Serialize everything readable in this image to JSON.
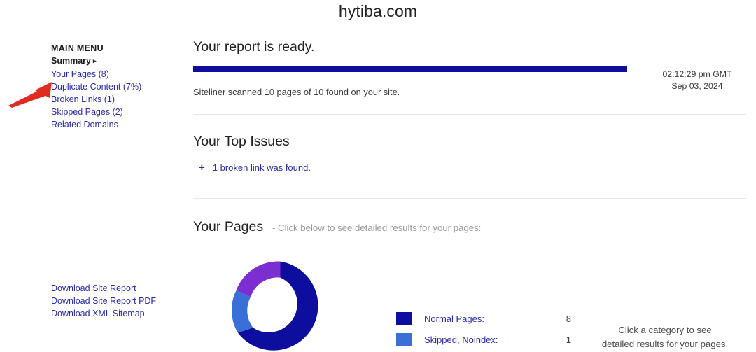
{
  "site": {
    "title": "hytiba.com"
  },
  "sidebar": {
    "heading": "MAIN MENU",
    "summary_label": "Summary",
    "summary_caret": "▸",
    "items": [
      {
        "label": "Your Pages (8)",
        "name": "sidebar-item-your-pages"
      },
      {
        "label": "Duplicate Content (7%)",
        "name": "sidebar-item-duplicate-content"
      },
      {
        "label": "Broken Links (1)",
        "name": "sidebar-item-broken-links"
      },
      {
        "label": "Skipped Pages (2)",
        "name": "sidebar-item-skipped-pages"
      },
      {
        "label": "Related Domains",
        "name": "sidebar-item-related-domains"
      }
    ],
    "downloads": [
      {
        "label": "Download Site Report"
      },
      {
        "label": "Download Site Report PDF"
      },
      {
        "label": "Download XML Sitemap"
      }
    ]
  },
  "annotation": {
    "arrow_color": "#e02b20",
    "points_at": "Duplicate Content (7%)"
  },
  "report": {
    "title": "Your report is ready.",
    "progress_percent": 100,
    "progress_color": "#0d0d9e",
    "scan_summary": "Siteliner scanned 10 pages of 10 found on your site.",
    "time": "02:12:29 pm GMT",
    "date": "Sep 03, 2024"
  },
  "top_issues": {
    "title": "Your Top Issues",
    "items": [
      {
        "expand_icon": "+",
        "text": "1 broken link was found."
      }
    ]
  },
  "your_pages": {
    "title": "Your Pages",
    "subtitle": "-  Click below to see detailed results for your pages:",
    "hint_line_1": "Click a category to see",
    "hint_line_2": "detailed results for your pages."
  },
  "chart_data": {
    "type": "pie",
    "title": "Your Pages",
    "donut": true,
    "start_angle_deg": 0,
    "direction": "clockwise",
    "legend_position": "right",
    "categories": [
      "Normal Pages",
      "Skipped, Noindex",
      "Duplicate Content"
    ],
    "values": [
      8,
      1,
      1
    ],
    "colors": [
      "#0d0d9e",
      "#3a6fd8",
      "#7b2fd0"
    ],
    "legend": [
      {
        "label": "Normal Pages:",
        "value": "8",
        "color": "#0d0d9e"
      },
      {
        "label": "Skipped, Noindex:",
        "value": "1",
        "color": "#3a6fd8"
      }
    ]
  }
}
